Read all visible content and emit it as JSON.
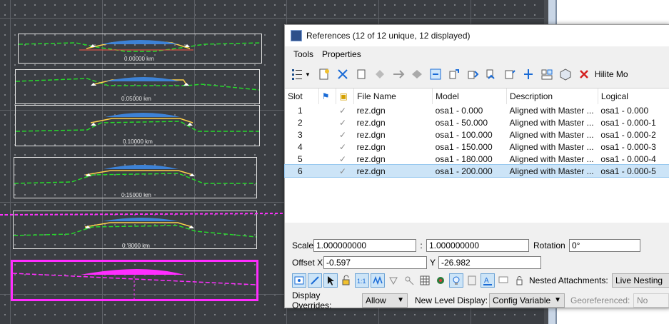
{
  "canvas": {
    "stations": [
      "0.00000 km",
      "0.05000 km",
      "0.10000 km",
      "0.15000 km",
      "0.'8000 km"
    ],
    "colors": {
      "ground": "#25d82a",
      "road": "#3d82d6",
      "frame": "#e6e6e6",
      "highlight": "#ff2dff",
      "annotation": "#ff5b45"
    }
  },
  "dialog": {
    "title": "References (12 of 12 unique, 12 displayed)",
    "menu": [
      "Tools",
      "Properties"
    ],
    "toolbar_hilite_label": "Hilite Mo",
    "columns": {
      "slot": "Slot",
      "file": "File Name",
      "model": "Model",
      "description": "Description",
      "logical": "Logical"
    },
    "rows": [
      {
        "slot": "1",
        "file": "rez.dgn",
        "model": "osa1 - 0.000",
        "description": "Aligned with Master ...",
        "logical": "osa1 - 0.000"
      },
      {
        "slot": "2",
        "file": "rez.dgn",
        "model": "osa1 - 50.000",
        "description": "Aligned with Master ...",
        "logical": "osa1 - 0.000-1"
      },
      {
        "slot": "3",
        "file": "rez.dgn",
        "model": "osa1 - 100.000",
        "description": "Aligned with Master ...",
        "logical": "osa1 - 0.000-2"
      },
      {
        "slot": "4",
        "file": "rez.dgn",
        "model": "osa1 - 150.000",
        "description": "Aligned with Master ...",
        "logical": "osa1 - 0.000-3"
      },
      {
        "slot": "5",
        "file": "rez.dgn",
        "model": "osa1 - 180.000",
        "description": "Aligned with Master ...",
        "logical": "osa1 - 0.000-4"
      },
      {
        "slot": "6",
        "file": "rez.dgn",
        "model": "osa1 - 200.000",
        "description": "Aligned with Master ...",
        "logical": "osa1 - 0.000-5"
      }
    ],
    "scale": {
      "label": "Scale",
      "value1": "1.000000000",
      "sep": ":",
      "value2": "1.000000000"
    },
    "rotation": {
      "label": "Rotation",
      "value": "0°"
    },
    "offset": {
      "label": "Offset X",
      "x_value": "-0.597",
      "y_label": "Y",
      "y_value": "-26.982"
    },
    "nested": {
      "label": "Nested Attachments:",
      "value": "Live Nesting"
    },
    "display_overrides": {
      "label": "Display Overrides:",
      "value": "Allow"
    },
    "new_level_display": {
      "label": "New Level Display:",
      "value": "Config Variable"
    },
    "georeferenced": {
      "label": "Georeferenced:",
      "value": "No"
    }
  }
}
